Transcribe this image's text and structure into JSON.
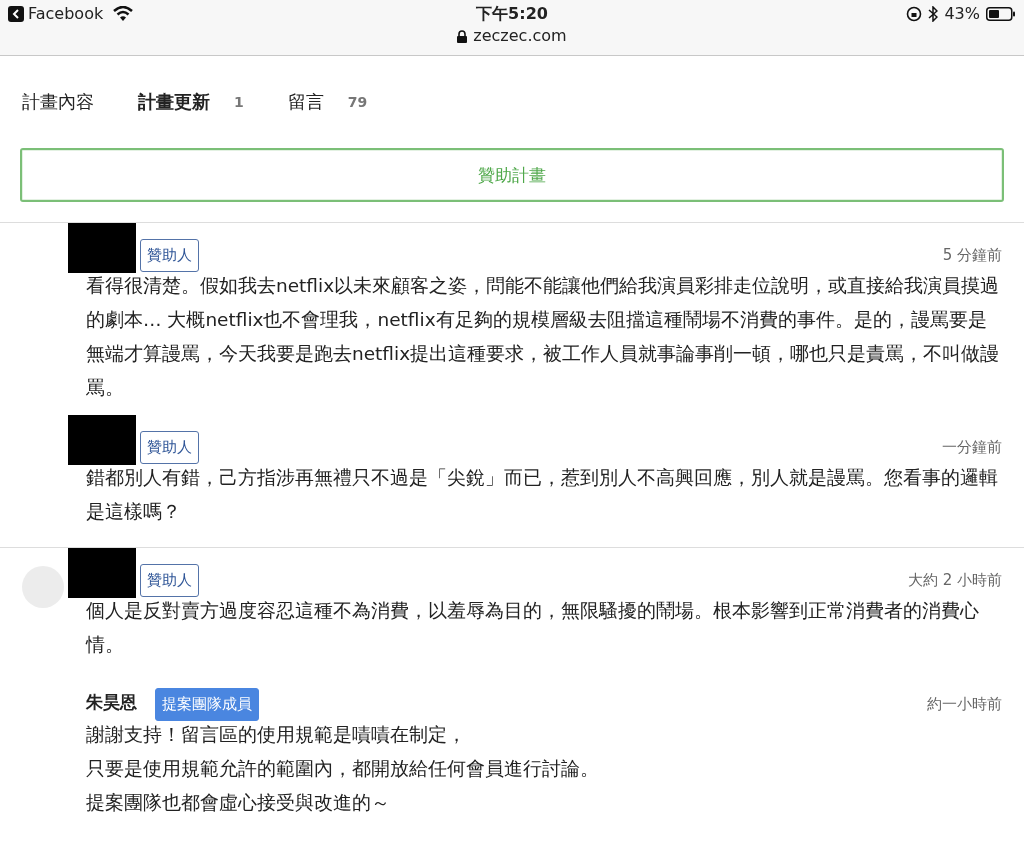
{
  "status_bar": {
    "back_app": "Facebook",
    "time": "下午5:20",
    "url": "zeczec.com",
    "battery": "43%"
  },
  "tabs": [
    {
      "label": "計畫內容",
      "selected": false
    },
    {
      "label": "計畫更新",
      "count": "1",
      "selected": true
    },
    {
      "label": "留言",
      "count": "79",
      "selected": false
    }
  ],
  "sponsor_button": "贊助計畫",
  "threads": [
    {
      "avatar": false,
      "comments": [
        {
          "author_hidden": true,
          "badge": {
            "kind": "sponsor",
            "label": "贊助人"
          },
          "time": "5 分鐘前",
          "lines": [
            "看得很清楚。假如我去netflix以未來顧客之姿，問能不能讓他們給我演員彩排走位說明，或直接給我演員摸過的劇本… 大概netflix也不會理我，netflix有足夠的規模層級去阻擋這種鬧場不消費的事件。是的，謾罵要是無端才算謾罵，今天我要是跑去netflix提出這種要求，被工作人員就事論事削一頓，哪也只是責罵，不叫做謾罵。"
          ]
        },
        {
          "author_hidden": true,
          "badge": {
            "kind": "sponsor",
            "label": "贊助人"
          },
          "time": "一分鐘前",
          "lines": [
            "錯都別人有錯，己方指涉再無禮只不過是「尖銳」而已，惹到別人不高興回應，別人就是謾罵。您看事的邏輯是這樣嗎？"
          ]
        }
      ]
    },
    {
      "avatar": true,
      "comments": [
        {
          "author_hidden": true,
          "badge": {
            "kind": "sponsor",
            "label": "贊助人"
          },
          "time": "大約 2 小時前",
          "lines": [
            "個人是反對賣方過度容忍這種不為消費，以羞辱為目的，無限騷擾的鬧場。根本影響到正常消費者的消費心情。"
          ]
        },
        {
          "author_hidden": false,
          "author": "朱昊恩",
          "badge": {
            "kind": "team",
            "label": "提案團隊成員"
          },
          "time": "約一小時前",
          "lines": [
            "謝謝支持！留言區的使用規範是嘖嘖在制定，",
            "只要是使用規範允許的範圍內，都開放給任何會員進行討論。",
            "提案團隊也都會虛心接受與改進的～"
          ]
        }
      ]
    }
  ]
}
